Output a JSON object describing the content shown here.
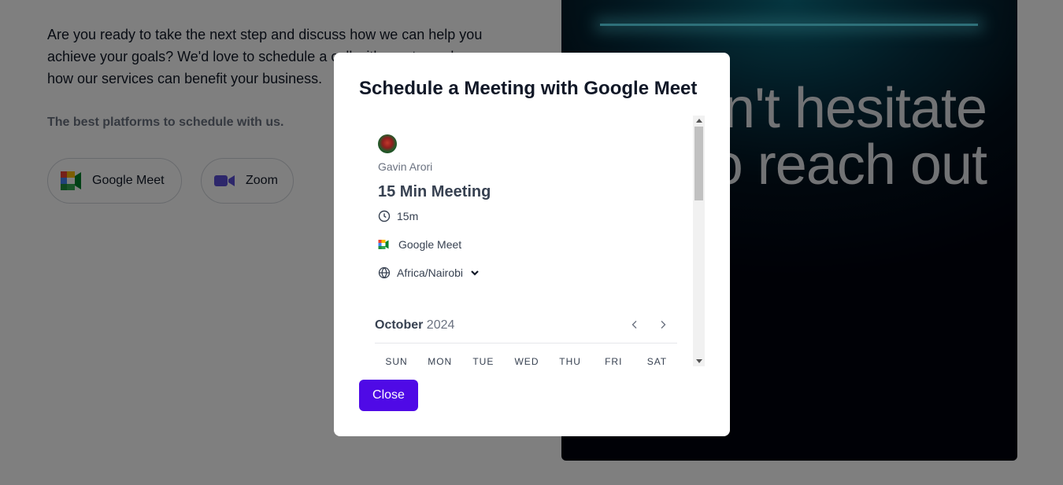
{
  "intro": {
    "paragraph": "Are you ready to take the next step and discuss how we can help you achieve your goals? We'd love to schedule a call with you to explore how our services can benefit your business.",
    "platforms_heading": "The best platforms to schedule with us."
  },
  "platforms": [
    {
      "label": "Google Meet",
      "icon": "google-meet-icon"
    },
    {
      "label": "Zoom",
      "icon": "zoom-icon"
    }
  ],
  "hero": {
    "text": "Don't hesitate to reach out",
    "accent_color": "#5ce1f2"
  },
  "modal": {
    "title": "Schedule a Meeting with Google Meet",
    "close_label": "Close",
    "close_color": "#4f0ae6"
  },
  "booking": {
    "organizer": "Gavin Arori",
    "event_title": "15 Min Meeting",
    "duration": "15m",
    "location": "Google Meet",
    "timezone": "Africa/Nairobi",
    "calendar": {
      "month": "October",
      "year": "2024",
      "weekdays": [
        "SUN",
        "MON",
        "TUE",
        "WED",
        "THU",
        "FRI",
        "SAT"
      ]
    }
  }
}
